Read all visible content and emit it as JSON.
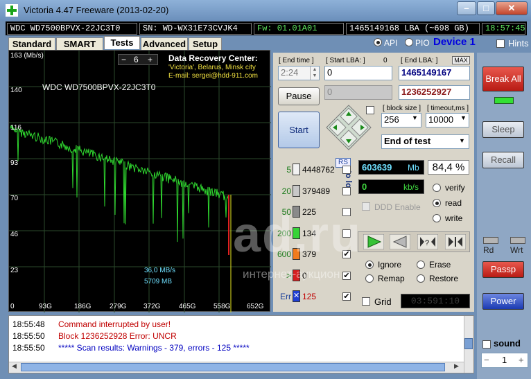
{
  "window": {
    "title": "Victoria 4.47  Freeware (2013-02-20)"
  },
  "info": {
    "model": "WDC WD7500BPVX-22JC3T0",
    "serial": "SN: WD-WX31E73CVJK4",
    "firmware": "Fw: 01.01A01",
    "lba": "1465149168 LBA (~698 GB)",
    "time": "18:57:45"
  },
  "tabs": [
    "Standard",
    "SMART",
    "Tests",
    "Advanced",
    "Setup"
  ],
  "mode": {
    "api": "API",
    "pio": "PIO",
    "device": "Device 1",
    "hints": "Hints"
  },
  "graph": {
    "unit": "163 (Mb/s)",
    "y_labels": [
      "140",
      "116",
      "93",
      "70",
      "46",
      "23",
      "0"
    ],
    "x_labels": [
      "93G",
      "186G",
      "279G",
      "372G",
      "465G",
      "558G",
      "652G"
    ],
    "drive": "WDC WD7500BPVX-22JC3T0",
    "step": "6",
    "minus": "−",
    "plus": "+",
    "promo_title": "Data Recovery Center:",
    "promo_line2": "'Victoria', Belarus, Minsk city",
    "promo_line3": "E-mail: sergei@hdd-911.com",
    "speed": "36,0 MB/s",
    "position": "5709 MB"
  },
  "controls": {
    "end_time_label": "[ End time ]",
    "end_time": "2:24",
    "start_lba_label": "[ Start LBA: ]",
    "start_lba_zero": "0",
    "start_lba": "0",
    "current_lba_grey": "0",
    "end_lba_label": "[ End LBA: ]",
    "max": "MAX",
    "end_lba": "1465149167",
    "current_lba": "1236252927",
    "pause": "Pause",
    "start": "Start",
    "block_size_label": "[ block size ]",
    "block_size": "256",
    "timeout_label": "[ timeout,ms ]",
    "timeout": "10000",
    "end_action": "End of test",
    "rs": "RS",
    "to_log": "to log:"
  },
  "buckets": [
    {
      "label": "5",
      "value": "4448762",
      "color": "#f2f2f2",
      "checked": ""
    },
    {
      "label": "20",
      "value": "379489",
      "color": "#c8c8c8",
      "checked": ""
    },
    {
      "label": "50",
      "value": "225",
      "color": "#8a8a8a",
      "checked": ""
    },
    {
      "label": "200",
      "value": "134",
      "color": "#37d437",
      "checked": ""
    },
    {
      "label": "600",
      "value": "379",
      "color": "#f07b1c",
      "checked": "✔"
    },
    {
      "label": ">",
      "value": "0",
      "color": "#d41f1f",
      "checked": "✔"
    },
    {
      "label": "Err",
      "value": "125",
      "color": "#1f3fd4",
      "checked": "✔",
      "mark": "✕"
    }
  ],
  "stats": {
    "mb": "603639",
    "mb_unit": "Mb",
    "percent": "84,4 %",
    "kbs": "0",
    "kbs_unit": "kb/s",
    "ddd": "DDD Enable",
    "verify": "verify",
    "read": "read",
    "write": "write",
    "ignore": "Ignore",
    "erase": "Erase",
    "remap": "Remap",
    "restore": "Restore",
    "grid": "Grid",
    "grid_time": "03:591:10"
  },
  "right": {
    "break": "Break All",
    "sleep": "Sleep",
    "recall": "Recall",
    "rd": "Rd",
    "wrt": "Wrt",
    "passp": "Passp",
    "power": "Power",
    "sound": "sound",
    "minus": "−",
    "plus": "+",
    "sound_value": "1"
  },
  "log": [
    {
      "time": "18:55:48",
      "msg": "Command interrupted by user!",
      "color": "#c00000"
    },
    {
      "time": "18:55:50",
      "msg": "Block 1236252928 Error: UNCR",
      "color": "#c00000"
    },
    {
      "time": "18:55:50",
      "msg": "***** Scan results: Warnings - 379, errors - 125 *****",
      "color": "#0000c0"
    }
  ],
  "watermark": {
    "big": "ad.ru",
    "small": "интернет-аукцион"
  }
}
